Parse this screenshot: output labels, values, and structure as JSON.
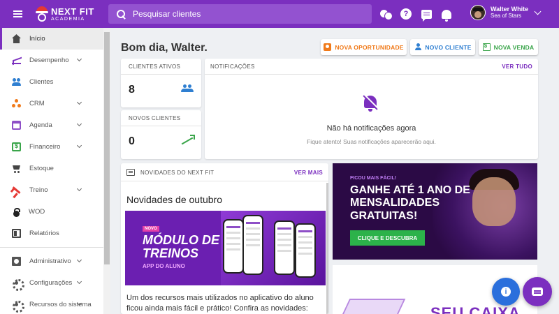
{
  "header": {
    "logo_line1": "NEXT FIT",
    "logo_line2": "ACADEMIA",
    "search_placeholder": "Pesquisar clientes",
    "user_name": "Walter White",
    "user_subtitle": "Sea of Stars",
    "icons": [
      "coins-icon",
      "help-icon",
      "chat-icon",
      "bell-icon"
    ]
  },
  "sidebar": {
    "items": [
      {
        "label": "Início",
        "icon": "home-icon",
        "expandable": false,
        "active": true
      },
      {
        "label": "Desempenho",
        "icon": "chart-icon",
        "expandable": true
      },
      {
        "label": "Clientes",
        "icon": "people-icon",
        "expandable": false
      },
      {
        "label": "CRM",
        "icon": "crm-icon",
        "expandable": true
      },
      {
        "label": "Agenda",
        "icon": "calendar-icon",
        "expandable": true
      },
      {
        "label": "Financeiro",
        "icon": "money-icon",
        "expandable": true
      },
      {
        "label": "Estoque",
        "icon": "cart-icon",
        "expandable": false
      },
      {
        "label": "Treino",
        "icon": "dumbbell-icon",
        "expandable": true
      },
      {
        "label": "WOD",
        "icon": "kettlebell-icon",
        "expandable": false
      },
      {
        "label": "Relatórios",
        "icon": "report-icon",
        "expandable": false
      },
      {
        "label": "Administrativo",
        "icon": "admin-icon",
        "expandable": true
      },
      {
        "label": "Configurações",
        "icon": "gear-icon",
        "expandable": true
      },
      {
        "label": "Recursos do sistema",
        "icon": "resources-icon",
        "expandable": true
      }
    ]
  },
  "main": {
    "greeting": "Bom dia, Walter.",
    "actions": {
      "opportunity": "NOVA OPORTUNIDADE",
      "client": "NOVO CLIENTE",
      "sale": "NOVA VENDA"
    },
    "stats": {
      "active_label": "CLIENTES ATIVOS",
      "active_value": "8",
      "new_label": "NOVOS CLIENTES",
      "new_value": "0"
    },
    "notifications": {
      "title": "NOTIFICAÇÕES",
      "link": "VER TUDO",
      "empty_title": "Não há notificações agora",
      "empty_sub": "Fique atento! Suas notificações aparecerão aqui."
    },
    "news": {
      "title": "NOVIDADES DO NEXT FIT",
      "link": "VER MAIS",
      "heading": "Novidades de outubro",
      "banner_badge": "NOVO",
      "banner_title": "MÓDULO DE TREINOS",
      "banner_sub": "APP DO ALUNO",
      "body": "Um dos recursos mais utilizados no aplicativo do aluno ficou ainda mais fácil e prático! Confira as novidades:"
    },
    "promo": {
      "small": "FICOU MAIS FÁCIL!",
      "title": "GANHE ATÉ 1 ANO DE MENSALIDADES GRATUITAS!",
      "button": "CLIQUE E DESCUBRA"
    },
    "promo2": {
      "text": "SEU CAIXA"
    }
  },
  "colors": {
    "brand": "#7b2fbf",
    "orange": "#f07a1a",
    "blue": "#2f7fd1",
    "green": "#3aa54a"
  }
}
